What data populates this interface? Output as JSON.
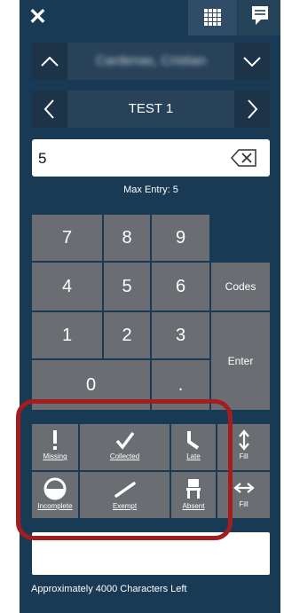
{
  "toolbar": {
    "close_glyph": "✕",
    "grid_icon": "grid-icon",
    "note_icon": "comment-icon"
  },
  "student_nav": {
    "name": "Cardenas, Cristian"
  },
  "test_nav": {
    "label": "TEST 1"
  },
  "entry": {
    "value": "5",
    "max_label": "Max Entry: 5"
  },
  "keypad": {
    "k7": "7",
    "k8": "8",
    "k9": "9",
    "k4": "4",
    "k5": "5",
    "k6": "6",
    "k1": "1",
    "k2": "2",
    "k3": "3",
    "k0": "0",
    "kdot": ".",
    "codes": "Codes",
    "enter": "Enter"
  },
  "codes": {
    "missing": "Missing",
    "collected": "Collected",
    "late": "Late",
    "fill_vertical": "Fill",
    "incomplete": "Incomplete",
    "exempt": "Exempt",
    "absent": "Absent",
    "fill_horizontal": "Fill"
  },
  "comment": {
    "chars_left": "Approximately 4000 Characters Left"
  },
  "colors": {
    "frame_bg": "#183a54",
    "key_bg": "#6a6d72",
    "highlight": "#a31d1f"
  }
}
